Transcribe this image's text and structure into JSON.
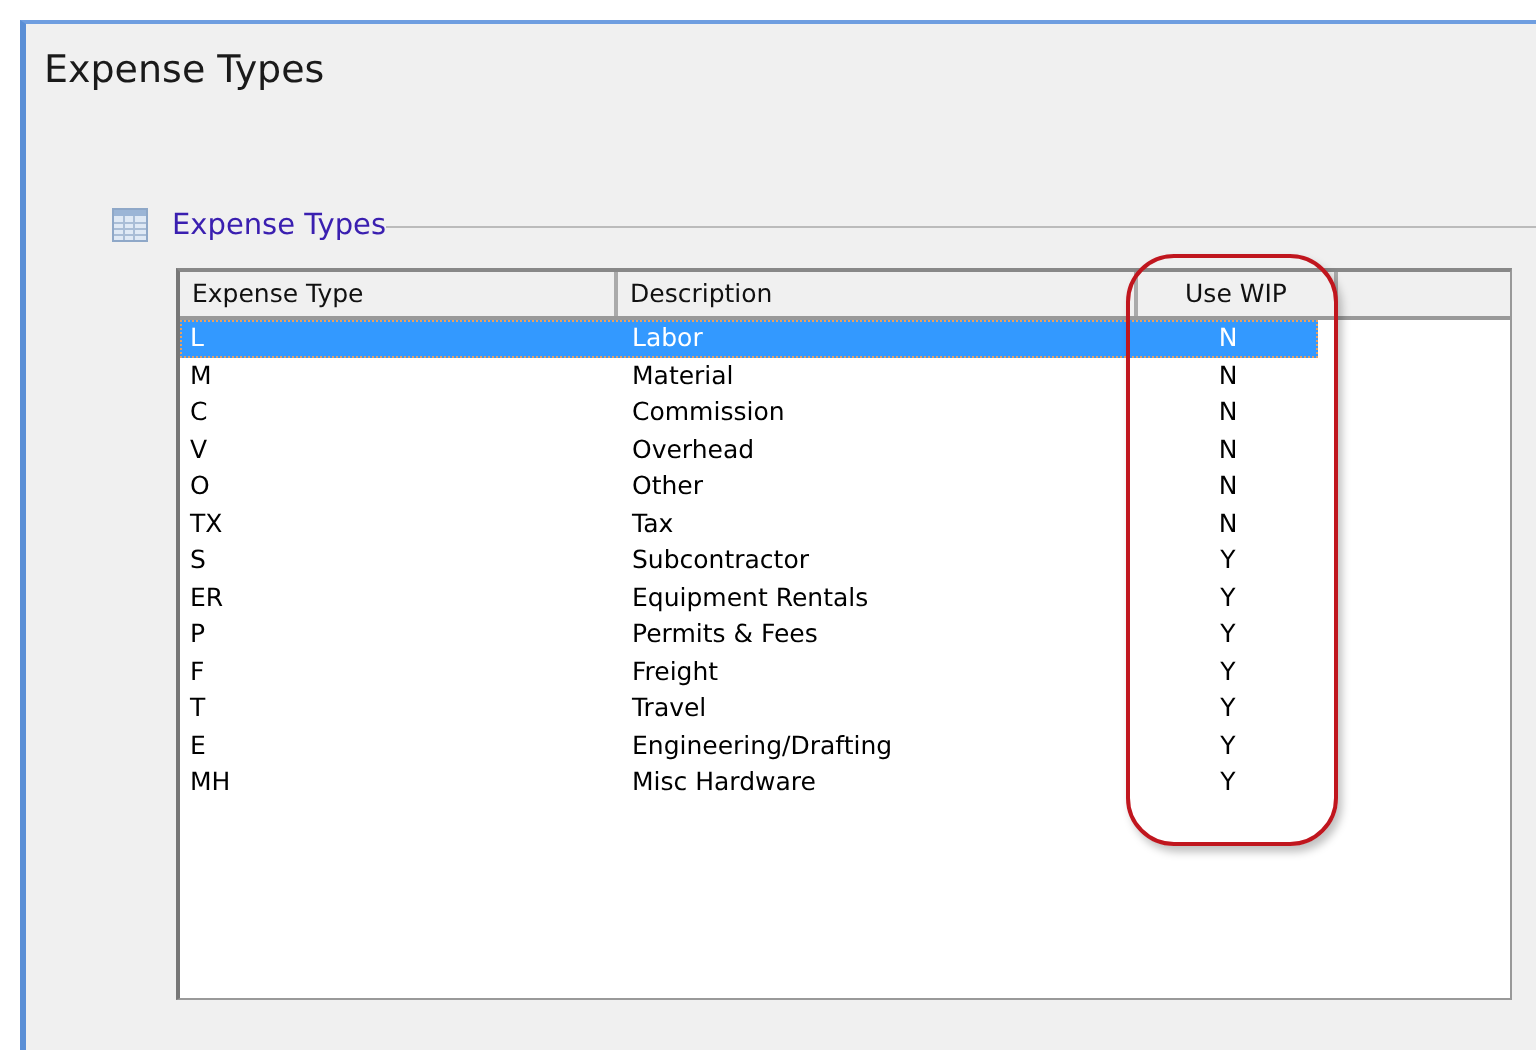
{
  "window": {
    "title": "Expense Types"
  },
  "group": {
    "title": "Expense Types"
  },
  "table": {
    "columns": [
      "Expense Type",
      "Description",
      "Use WIP"
    ],
    "rows": [
      {
        "cells": [
          "L",
          "Labor",
          "N"
        ],
        "selected": true
      },
      {
        "cells": [
          "M",
          "Material",
          "N"
        ],
        "selected": false
      },
      {
        "cells": [
          "C",
          "Commission",
          "N"
        ],
        "selected": false
      },
      {
        "cells": [
          "V",
          "Overhead",
          "N"
        ],
        "selected": false
      },
      {
        "cells": [
          "O",
          "Other",
          "N"
        ],
        "selected": false
      },
      {
        "cells": [
          "TX",
          "Tax",
          "N"
        ],
        "selected": false
      },
      {
        "cells": [
          "S",
          "Subcontractor",
          "Y"
        ],
        "selected": false
      },
      {
        "cells": [
          "ER",
          "Equipment Rentals",
          "Y"
        ],
        "selected": false
      },
      {
        "cells": [
          "P",
          "Permits & Fees",
          "Y"
        ],
        "selected": false
      },
      {
        "cells": [
          "F",
          "Freight",
          "Y"
        ],
        "selected": false
      },
      {
        "cells": [
          "T",
          "Travel",
          "Y"
        ],
        "selected": false
      },
      {
        "cells": [
          "E",
          "Engineering/Drafting",
          "Y"
        ],
        "selected": false
      },
      {
        "cells": [
          "MH",
          "Misc Hardware",
          "Y"
        ],
        "selected": false
      }
    ]
  }
}
